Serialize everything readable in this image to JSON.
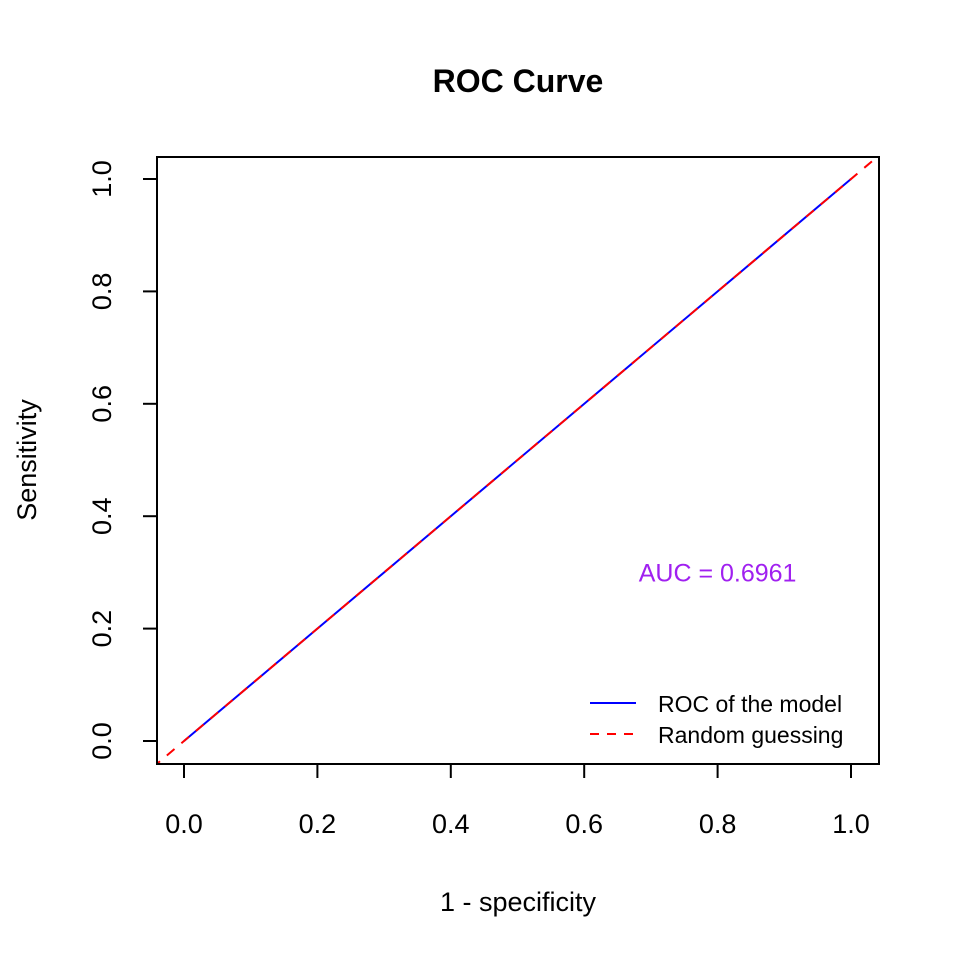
{
  "chart_data": {
    "type": "line",
    "title": "ROC Curve",
    "xlabel": "1 - specificity",
    "ylabel": "Sensitivity",
    "xlim": [
      0,
      1
    ],
    "ylim": [
      0,
      1
    ],
    "xticks": [
      0.0,
      0.2,
      0.4,
      0.6,
      0.8,
      1.0
    ],
    "xtick_labels": [
      "0.0",
      "0.2",
      "0.4",
      "0.6",
      "0.8",
      "1.0"
    ],
    "yticks": [
      0.0,
      0.2,
      0.4,
      0.6,
      0.8,
      1.0
    ],
    "ytick_labels": [
      "0.0",
      "0.2",
      "0.4",
      "0.6",
      "0.8",
      "1.0"
    ],
    "grid": false,
    "series": [
      {
        "name": "ROC of the model",
        "style": "solid",
        "color": "#0000ff",
        "x": [
          0,
          1
        ],
        "y": [
          0,
          1
        ]
      },
      {
        "name": "Random guessing",
        "style": "dashed",
        "color": "#ff0000",
        "abline": {
          "intercept": 0,
          "slope": 1
        }
      }
    ],
    "legend": {
      "position": "bottom-right",
      "entries": [
        "ROC of the model",
        "Random guessing"
      ]
    },
    "annotations": [
      {
        "text": "AUC =  0.6961",
        "x": 0.8,
        "y": 0.3,
        "color": "#a020f0"
      }
    ]
  }
}
